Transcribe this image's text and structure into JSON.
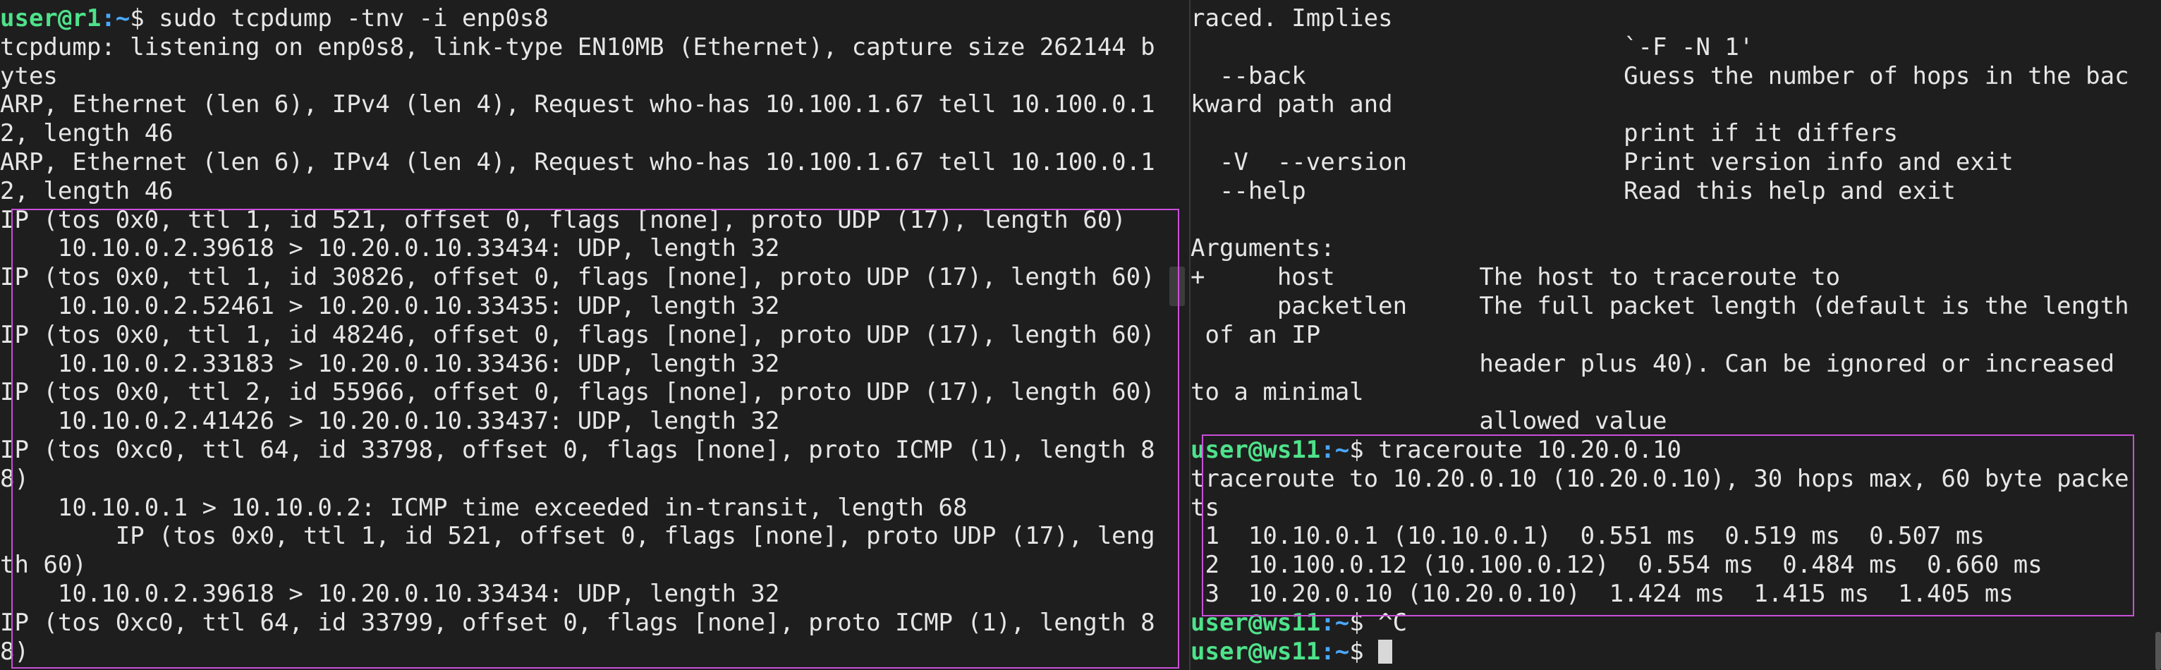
{
  "left_pane": {
    "prompt_user": "user@r1",
    "prompt_path": ":~",
    "command": "$ sudo tcpdump -tnv -i enp0s8",
    "lines": [
      "tcpdump: listening on enp0s8, link-type EN10MB (Ethernet), capture size 262144 b",
      "ytes",
      "ARP, Ethernet (len 6), IPv4 (len 4), Request who-has 10.100.1.67 tell 10.100.0.1",
      "2, length 46",
      "ARP, Ethernet (len 6), IPv4 (len 4), Request who-has 10.100.1.67 tell 10.100.0.1",
      "2, length 46",
      "IP (tos 0x0, ttl 1, id 521, offset 0, flags [none], proto UDP (17), length 60)",
      "    10.10.0.2.39618 > 10.20.0.10.33434: UDP, length 32",
      "IP (tos 0x0, ttl 1, id 30826, offset 0, flags [none], proto UDP (17), length 60)",
      "    10.10.0.2.52461 > 10.20.0.10.33435: UDP, length 32",
      "IP (tos 0x0, ttl 1, id 48246, offset 0, flags [none], proto UDP (17), length 60)",
      "    10.10.0.2.33183 > 10.20.0.10.33436: UDP, length 32",
      "IP (tos 0x0, ttl 2, id 55966, offset 0, flags [none], proto UDP (17), length 60)",
      "    10.10.0.2.41426 > 10.20.0.10.33437: UDP, length 32",
      "IP (tos 0xc0, ttl 64, id 33798, offset 0, flags [none], proto ICMP (1), length 8",
      "8)",
      "    10.10.0.1 > 10.10.0.2: ICMP time exceeded in-transit, length 68",
      "        IP (tos 0x0, ttl 1, id 521, offset 0, flags [none], proto UDP (17), leng",
      "th 60)",
      "    10.10.0.2.39618 > 10.20.0.10.33434: UDP, length 32",
      "IP (tos 0xc0, ttl 64, id 33799, offset 0, flags [none], proto ICMP (1), length 8",
      "8)"
    ]
  },
  "right_pane": {
    "help_lines": [
      "raced. Implies",
      "                              `-F -N 1'",
      "  --back                      Guess the number of hops in the bac",
      "kward path and",
      "                              print if it differs",
      "  -V  --version               Print version info and exit",
      "  --help                      Read this help and exit",
      "",
      "Arguments:",
      "+     host          The host to traceroute to",
      "      packetlen     The full packet length (default is the length",
      " of an IP",
      "                    header plus 40). Can be ignored or increased",
      "to a minimal",
      "                    allowed value"
    ],
    "prompt_user": "user@ws11",
    "prompt_path": ":~",
    "traceroute_command": "$ traceroute 10.20.0.10",
    "traceroute_output": [
      "traceroute to 10.20.0.10 (10.20.0.10), 30 hops max, 60 byte packe",
      "ts",
      " 1  10.10.0.1 (10.10.0.1)  0.551 ms  0.519 ms  0.507 ms",
      " 2  10.100.0.12 (10.100.0.12)  0.554 ms  0.484 ms  0.660 ms",
      " 3  10.20.0.10 (10.20.0.10)  1.424 ms  1.415 ms  1.405 ms"
    ],
    "interrupt_command": "$ ^C",
    "last_prompt": "$ "
  },
  "colors": {
    "background": "#1e1e1e",
    "text": "#e6e6e6",
    "prompt_user": "#4ee28a",
    "prompt_path": "#4aa8ff",
    "highlight": "#c94fd8"
  }
}
